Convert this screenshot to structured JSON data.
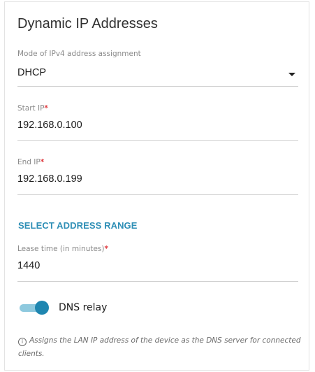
{
  "section": {
    "title": "Dynamic IP Addresses"
  },
  "mode": {
    "label": "Mode of IPv4 address assignment",
    "value": "DHCP"
  },
  "start_ip": {
    "label": "Start IP",
    "required_mark": "*",
    "value": "192.168.0.100"
  },
  "end_ip": {
    "label": "End IP",
    "required_mark": "*",
    "value": "192.168.0.199"
  },
  "select_range": {
    "label": "SELECT ADDRESS RANGE"
  },
  "lease_time": {
    "label": "Lease time (in minutes)",
    "required_mark": "*",
    "value": "1440"
  },
  "dns_relay": {
    "label": "DNS relay",
    "enabled": true
  },
  "info": {
    "icon": "info-icon",
    "text": "Assigns the LAN IP address of the device as the DNS server for connected clients."
  },
  "colors": {
    "accent": "#2f8fb6",
    "toggle_knob": "#1f86b0",
    "toggle_track": "#8ec9de",
    "required": "#e0393e"
  }
}
